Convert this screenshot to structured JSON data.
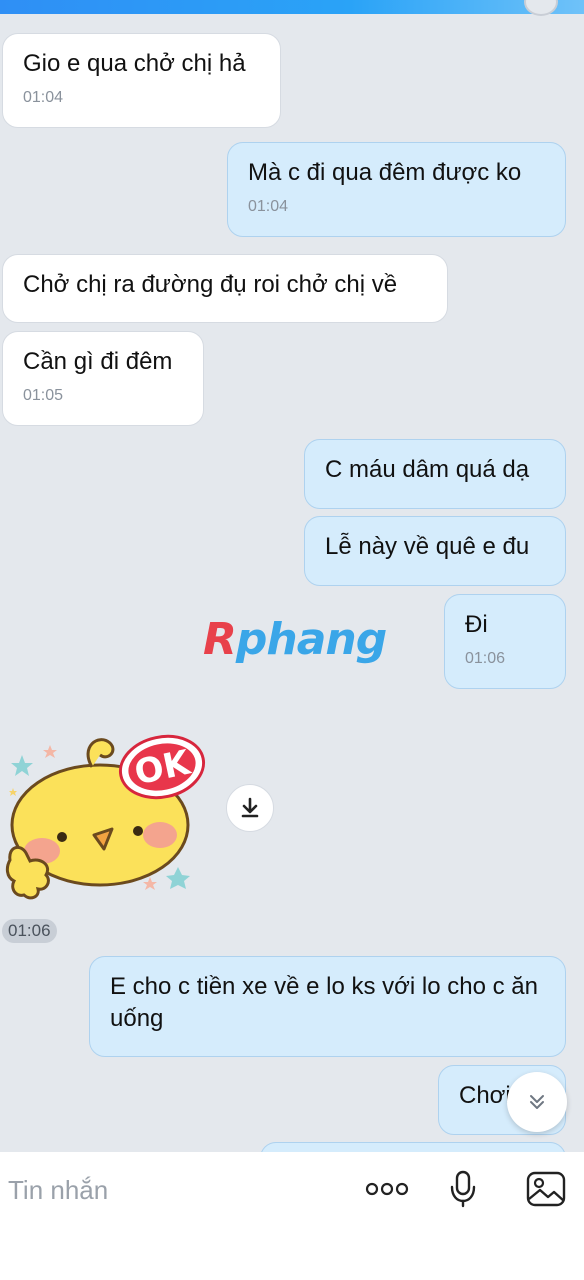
{
  "messages": [
    {
      "text": "Gio e qua chở chị hả",
      "time": "01:04"
    },
    {
      "text": "Mà c đi qua đêm được ko",
      "time": "01:04"
    },
    {
      "text": "Chở chị ra đường đụ roi chở chị về"
    },
    {
      "text": "Cần gì đi đêm",
      "time": "01:05"
    },
    {
      "text": "C máu dâm quá dạ"
    },
    {
      "text": "Lễ này về quê e đu"
    },
    {
      "text": "Đi",
      "time": "01:06"
    },
    {
      "text": "E cho c tiền xe về e lo ks với lo cho c ăn uống"
    },
    {
      "text": "Chơi"
    }
  ],
  "watermark": {
    "r": "R",
    "rest": "phang"
  },
  "sticker": {
    "label": "OK",
    "time": "01:06",
    "icon": "download-icon"
  },
  "composer": {
    "placeholder": "Tin nhắn"
  },
  "icons": [
    "more-icon",
    "microphone-icon",
    "image-icon",
    "chevron-down-icon"
  ],
  "colors": {
    "sent_bubble": "#d5ecfc",
    "received_bubble": "#ffffff",
    "background": "#e4e8ed",
    "accent": "#2f8ff5"
  }
}
